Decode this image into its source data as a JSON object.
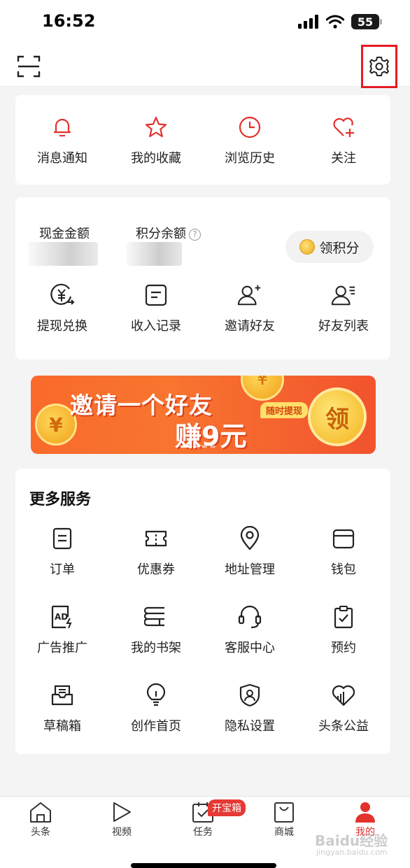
{
  "status_bar": {
    "time": "16:52",
    "battery": "55"
  },
  "quick_links": [
    {
      "label": "消息通知",
      "icon": "bell-icon"
    },
    {
      "label": "我的收藏",
      "icon": "star-icon"
    },
    {
      "label": "浏览历史",
      "icon": "clock-icon"
    },
    {
      "label": "关注",
      "icon": "heart-plus-icon"
    }
  ],
  "wallet": {
    "cash_label": "现金金额",
    "points_label": "积分余额",
    "help": "?",
    "claim_points_label": "领积分",
    "actions": [
      {
        "label": "提现兑换",
        "icon": "yuan-exchange-icon"
      },
      {
        "label": "收入记录",
        "icon": "record-icon"
      },
      {
        "label": "邀请好友",
        "icon": "add-user-icon"
      },
      {
        "label": "好友列表",
        "icon": "user-list-icon"
      }
    ]
  },
  "banner": {
    "title": "邀请一个好友",
    "subtitle": "赚9元",
    "tag": "随时提现",
    "button": "领",
    "coin_glyph": "¥"
  },
  "services": {
    "title": "更多服务",
    "items": [
      {
        "label": "订单",
        "icon": "order-icon"
      },
      {
        "label": "优惠券",
        "icon": "coupon-icon"
      },
      {
        "label": "地址管理",
        "icon": "location-icon"
      },
      {
        "label": "钱包",
        "icon": "wallet-icon"
      },
      {
        "label": "广告推广",
        "icon": "ad-icon"
      },
      {
        "label": "我的书架",
        "icon": "bookshelf-icon"
      },
      {
        "label": "客服中心",
        "icon": "headset-icon"
      },
      {
        "label": "预约",
        "icon": "clipboard-check-icon"
      },
      {
        "label": "草稿箱",
        "icon": "draft-box-icon"
      },
      {
        "label": "创作首页",
        "icon": "lightbulb-icon"
      },
      {
        "label": "隐私设置",
        "icon": "privacy-shield-icon"
      },
      {
        "label": "头条公益",
        "icon": "charity-heart-icon"
      }
    ]
  },
  "bottom_nav": {
    "items": [
      {
        "label": "头条",
        "icon": "home-icon"
      },
      {
        "label": "视频",
        "icon": "play-icon"
      },
      {
        "label": "任务",
        "icon": "task-icon"
      },
      {
        "label": "商城",
        "icon": "shopping-bag-icon"
      },
      {
        "label": "我的",
        "icon": "profile-icon"
      }
    ],
    "task_badge": "开宝箱",
    "active_index": 4
  },
  "watermark": {
    "text": "Baidu经验",
    "url": "jingyan.baidu.com"
  },
  "colors": {
    "accent_red": "#e3312d",
    "highlight_border": "#e41b23",
    "icon_dark": "#222222"
  }
}
